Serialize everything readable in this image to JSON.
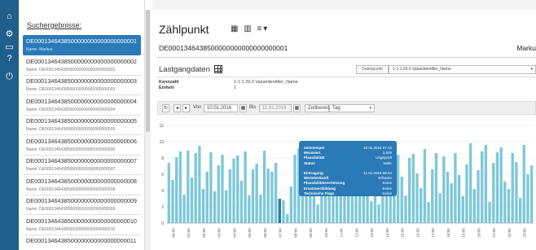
{
  "sidebar_rail": {
    "icons": [
      "home-icon",
      "gear-icon",
      "monitor-icon",
      "help-icon",
      "power-icon"
    ]
  },
  "results": {
    "title": "Suchergebnisse:",
    "items": [
      {
        "id": "DE0001346438500000000000000000001",
        "name": "Name: Markus",
        "active": true
      },
      {
        "id": "DE0001346438500000000000000000002",
        "name": "Name: DE0001346438500000000000000000002"
      },
      {
        "id": "DE0001346438500000000000000000003",
        "name": "Name: DE0001346438500000000000000000003"
      },
      {
        "id": "DE0001346438500000000000000000004",
        "name": "Name: DE0001346438500000000000000000004"
      },
      {
        "id": "DE0001346438500000000000000000005",
        "name": "Name: DE0001346438500000000000000000005"
      },
      {
        "id": "DE0001346438500000000000000000006",
        "name": "Name: DE0001346438500000000000000000006"
      },
      {
        "id": "DE0001346438500000000000000000007",
        "name": "Name: DE0001346438500000000000000000007"
      },
      {
        "id": "DE0001346438500000000000000000008",
        "name": "Name: DE0001346438500000000000000000008"
      },
      {
        "id": "DE0001346438500000000000000000009",
        "name": "Name: DE0001346438500000000000000000009"
      },
      {
        "id": "DE0001346438500000000000000000010",
        "name": "Name: DE0001346438500000000000000000010"
      },
      {
        "id": "DE0001346438500000000000000000011",
        "name": ""
      }
    ]
  },
  "main": {
    "title": "Zählpunkt",
    "title_icons": "▦ ▥ ≡▾",
    "zaehlpunkt_id": "DE0001346438500000000000000000001",
    "right_label": "Marku",
    "section_title": "Lastgangdaten",
    "datapoint_label": "Datenpunkt",
    "datapoint_value": "1-1:1.29.0 ValueIdentifier_Name",
    "kennzahl_label": "Kennzahl",
    "kennzahl_value": "1-1:1.29.0 ValueIdentifier_Name",
    "einheit_label": "Einheit",
    "einheit_value": "1"
  },
  "toolbar": {
    "refresh": "↻",
    "prev": "◂",
    "next": "▸",
    "von_label": "Von",
    "von_value": "10.01.2016",
    "bis_label": "Bis",
    "bis_value": "11.01.2016",
    "zeitbereich_label": "Zeitbereich",
    "zeitbereich_value": "Tag"
  },
  "tooltip": {
    "rows": [
      {
        "k": "Zeitstempel",
        "v": "10.01.2016 07:15"
      },
      {
        "k": "Messwert",
        "v": "2,629"
      },
      {
        "k": "Plausibilität",
        "v": "Ungeprüft"
      },
      {
        "k": "Status",
        "v": "Wahr"
      },
      {
        "k": "",
        "v": ""
      },
      {
        "k": "Eintragung",
        "v": "11.01.2016 08:44"
      },
      {
        "k": "Werteherkunft",
        "v": "Erfasste"
      },
      {
        "k": "Plausibilitätsverletzung",
        "v": "Keine"
      },
      {
        "k": "Ersatzwertbildung",
        "v": "Keine"
      },
      {
        "k": "Technische Flags",
        "v": "Keine"
      }
    ]
  },
  "colors": {
    "rail": "#1f5f8b",
    "active_item": "#2a7ab8",
    "bar": "#7ec8d8",
    "bar_highlight": "#2a7ab8"
  },
  "chart_data": {
    "type": "bar",
    "ylim": [
      0,
      12
    ],
    "yticks": [
      "0",
      "2",
      "4",
      "6",
      "8",
      "10",
      "12"
    ],
    "xticks": [
      "00:00",
      "01:00",
      "02:00",
      "03:00",
      "04:00",
      "05:00",
      "06:00",
      "07:00",
      "08:00",
      "09:00",
      "10:00",
      "11:00",
      "12:00",
      "13:00",
      "14:00",
      "15:00",
      "16:00",
      "17:00",
      "18:00",
      "19:00",
      "20:00",
      "21:00",
      "22:00",
      "23:00"
    ],
    "highlight_index": 29,
    "values": [
      7.4,
      5.3,
      8.1,
      8.8,
      3.5,
      8.9,
      5.6,
      8.6,
      9.5,
      4.2,
      6.3,
      8.7,
      3.9,
      7.1,
      8.4,
      4.0,
      6.6,
      7.9,
      8.3,
      5.2,
      8.8,
      3.4,
      6.6,
      7.3,
      3.5,
      8.9,
      6.7,
      6.3,
      7.4,
      3.0,
      2.8,
      1.1,
      4.5,
      8.4,
      9.2,
      3.8,
      8.0,
      9.4,
      8.5,
      2.3,
      6.5,
      8.6,
      5.2,
      7.1,
      3.9,
      6.1,
      7.3,
      4.7,
      8.3,
      6.8,
      3.3,
      6.0,
      7.6,
      2.7,
      5.9,
      2.3,
      8.3,
      4.0,
      8.4,
      6.3,
      8.4,
      5.7,
      3.4,
      8.0,
      8.5,
      6.1,
      4.3,
      9.1,
      2.6,
      6.6,
      8.6,
      3.7,
      8.2,
      6.3,
      4.9,
      8.6,
      5.9,
      3.3,
      7.2,
      9.8,
      4.2,
      6.5,
      8.8,
      9.6,
      2.6,
      7.4,
      8.7,
      9.3,
      5.1,
      4.2,
      8.6,
      7.5,
      3.1,
      9.6,
      6.0,
      7.1
    ]
  }
}
